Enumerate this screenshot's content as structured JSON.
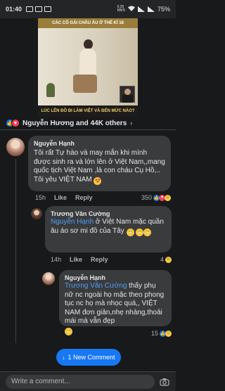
{
  "status_bar": {
    "time": "01:40",
    "battery": "75%",
    "network_speed": "0.25\nKB/S"
  },
  "video": {
    "banner_top": "CÁC CÔ GÁI CHÂU ÂU Ở THẾ KỈ 18",
    "banner_bottom": "LÚC LÊN ĐỒ ĐI LÀM VIỆT VÀ ĐẾN MỨC NÀO?"
  },
  "reactions": {
    "summary": "Nguyễn Hương and 44K others",
    "icons": [
      "like-icon",
      "love-icon"
    ]
  },
  "comments": [
    {
      "author": "Nguyễn Hạnh",
      "text": "Tôi rất Tự hào và may mắn khi mình được sinh ra và lớn lên ở Việt Nam,,mang quốc tịch Việt Nam ,là con cháu Cụ Hồ,.. Tôi yêu VIỆT NAM",
      "time": "15h",
      "like_label": "Like",
      "reply_label": "Reply",
      "reaction_count": "350"
    },
    {
      "author": "Trương Văn Cường",
      "mention": "Nguyễn Hạnh",
      "text": " ở Việt Nam mặc quần âu áo sơ mi đồ của Tây ",
      "time": "14h",
      "like_label": "Like",
      "reply_label": "Reply",
      "reaction_count": "4"
    },
    {
      "author": "Nguyễn Hạnh",
      "mention": "Trương Văn Cường",
      "text": " thấy phụ nữ nc ngoài họ mặc theo phong tục nc họ mà nhọc quá,, VIỆT NAM đơn giản,nhẹ nhàng,thoải mái mà vẫn đẹp",
      "time": "",
      "like_label": "Like",
      "reply_label": "Reply",
      "reaction_count": "15"
    }
  ],
  "new_comment_button": "1 New Comment",
  "composer": {
    "placeholder": "Write a comment..."
  },
  "colors": {
    "accent": "#1877f2",
    "background": "#18191a",
    "bubble": "#3a3b3c",
    "mention": "#4f9dfc"
  }
}
